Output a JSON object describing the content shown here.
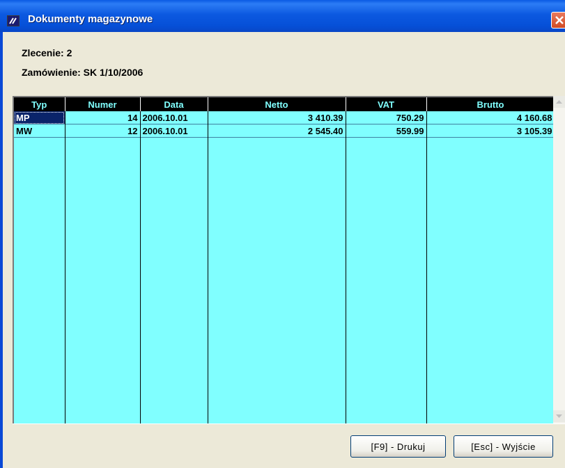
{
  "window": {
    "title": "Dokumenty magazynowe",
    "icon": "app-logo-icon",
    "close_icon": "close-x-icon"
  },
  "info": {
    "zlecenie": "Zlecenie: 2",
    "zamowienie": "Zamówienie: SK 1/10/2006"
  },
  "table": {
    "columns": [
      "Typ",
      "Numer",
      "Data",
      "Netto",
      "VAT",
      "Brutto"
    ],
    "rows": [
      {
        "typ": "MP",
        "numer": "14",
        "data": "2006.10.01",
        "netto": "3 410.39",
        "vat": "750.29",
        "brutto": "4 160.68"
      },
      {
        "typ": "MW",
        "numer": "12",
        "data": "2006.10.01",
        "netto": "2 545.40",
        "vat": "559.99",
        "brutto": "3 105.39"
      }
    ],
    "selected_row": 0
  },
  "buttons": {
    "print": "[F9] - Drukuj",
    "exit": "[Esc] - Wyjście"
  },
  "colors": {
    "grid_background": "#80FFFF",
    "header_background": "#000000",
    "header_text": "#80FFFF",
    "selection": "#0A246A"
  }
}
